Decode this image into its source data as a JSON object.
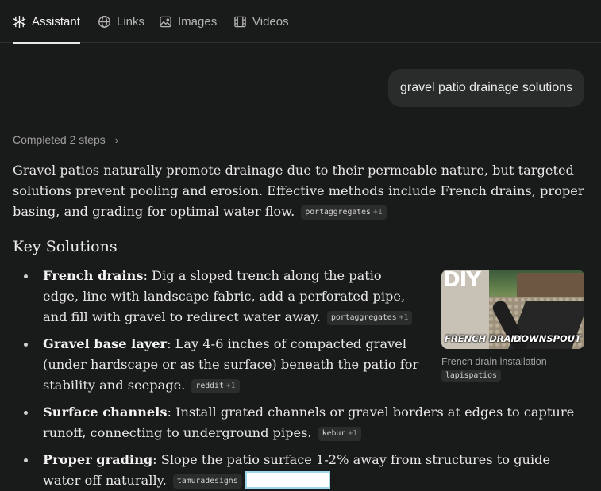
{
  "tabs": [
    {
      "label": "Assistant",
      "icon": "assistant-icon",
      "active": true
    },
    {
      "label": "Links",
      "icon": "globe-icon",
      "active": false
    },
    {
      "label": "Images",
      "icon": "image-icon",
      "active": false
    },
    {
      "label": "Videos",
      "icon": "video-icon",
      "active": false
    }
  ],
  "query": "gravel patio drainage solutions",
  "steps": {
    "label": "Completed 2 steps"
  },
  "intro": {
    "text": "Gravel patios naturally promote drainage due to their permeable nature, but targeted solutions prevent pooling and erosion. Effective methods include French drains, proper basing, and grading for optimal water flow.",
    "cite": {
      "source": "portaggregates",
      "more": "+1"
    }
  },
  "heading": "Key Solutions",
  "items": [
    {
      "title": "French drains",
      "text": ": Dig a sloped trench along the patio edge, line with landscape fabric, add a perforated pipe, and fill with gravel to redirect water away.",
      "cite": {
        "source": "portaggregates",
        "more": "+1"
      }
    },
    {
      "title": "Gravel base layer",
      "text": ": Lay 4-6 inches of compacted gravel (under hardscape or as the surface) beneath the patio for stability and seepage.",
      "cite": {
        "source": "reddit",
        "more": "+1"
      }
    },
    {
      "title": "Surface channels",
      "text": ": Install grated channels or gravel borders at edges to capture runoff, connecting to underground pipes.",
      "cite": {
        "source": "kebur",
        "more": "+1"
      }
    },
    {
      "title": "Proper grading",
      "text": ": Slope the patio surface 1-2% away from structures to guide water off naturally.",
      "cite": {
        "source": "tamuradesigns",
        "more": ""
      }
    }
  ],
  "figure": {
    "overlay_top": "DIY",
    "overlay_left": "FRENCH DRAIN",
    "overlay_right": "DOWNSPOUT",
    "caption": "French drain installation",
    "source": "lapispatios"
  }
}
